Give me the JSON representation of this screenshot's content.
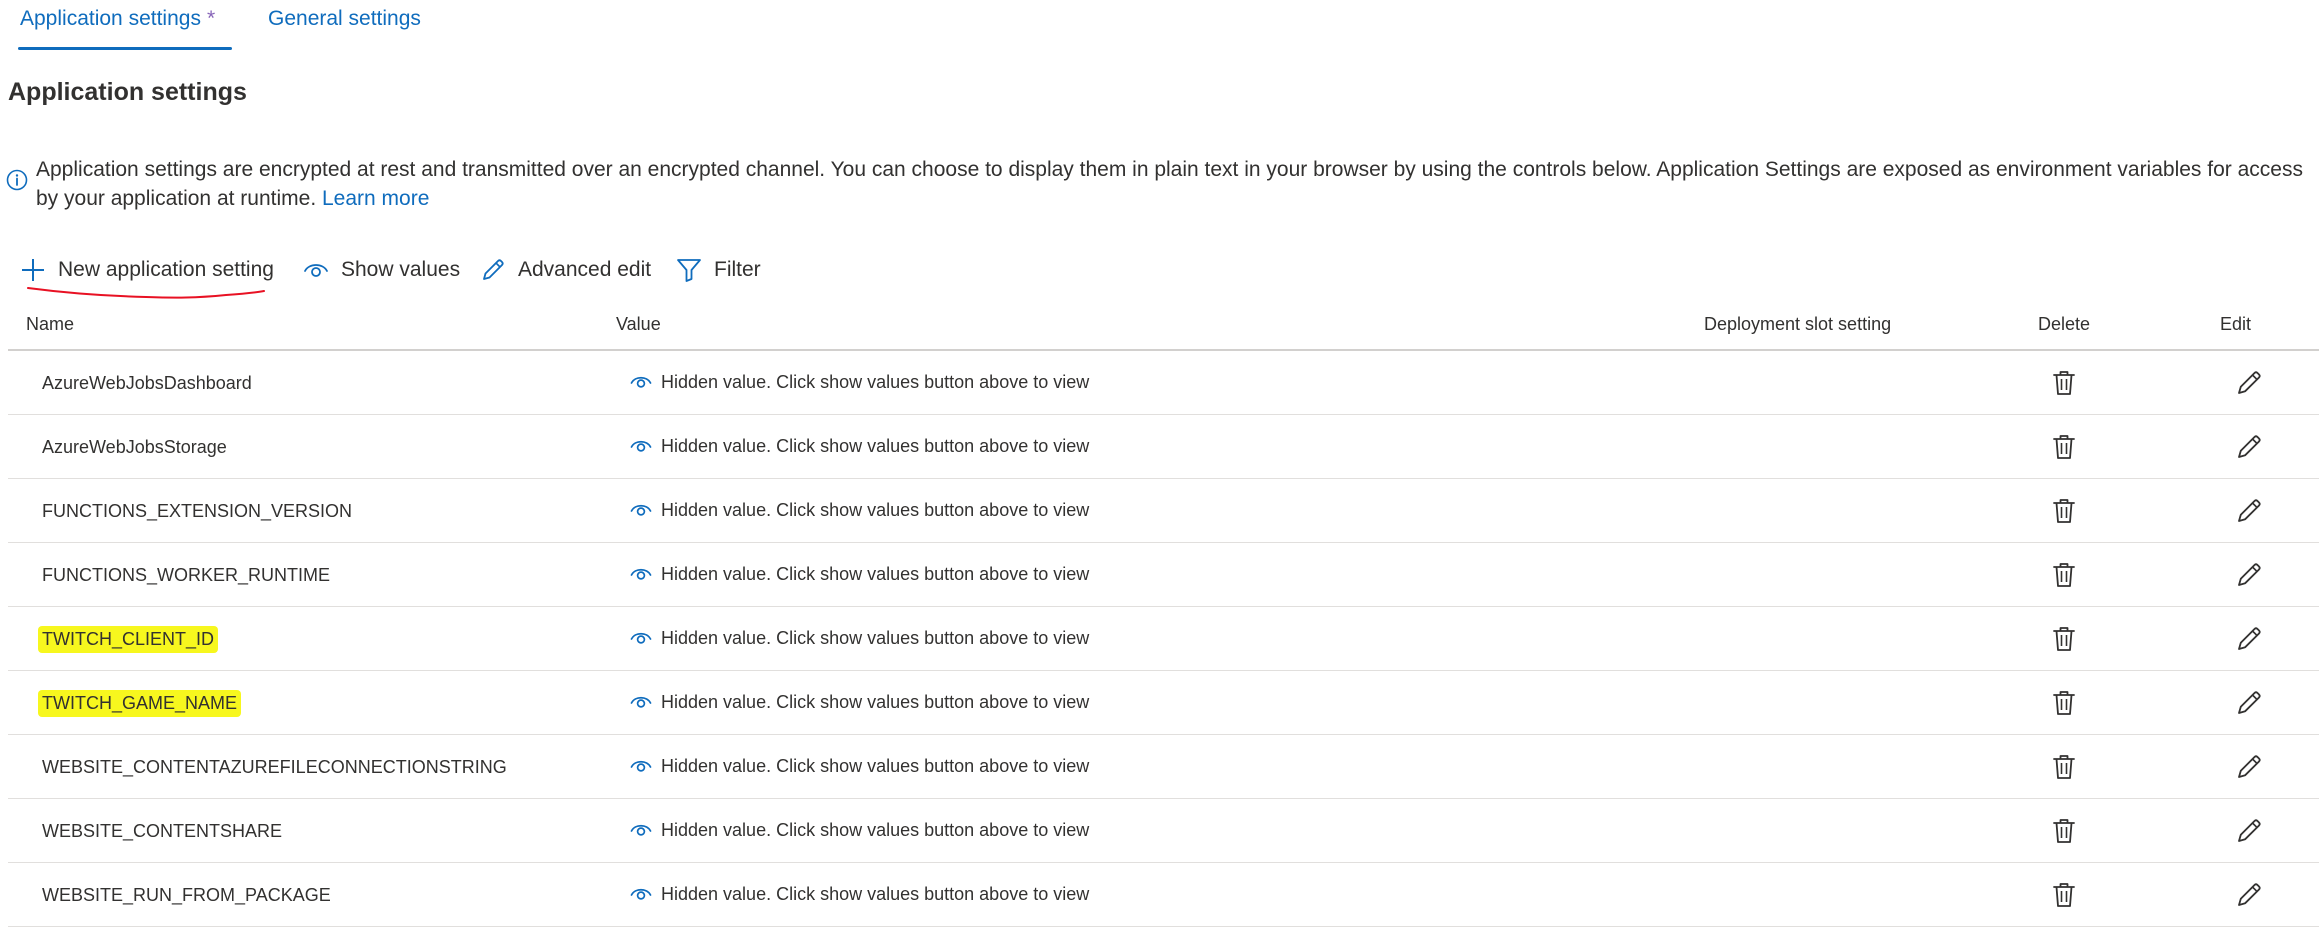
{
  "tabs": {
    "active_label": "Application settings",
    "active_modified_marker": "*",
    "general_label": "General settings"
  },
  "section": {
    "title": "Application settings"
  },
  "info": {
    "text": "Application settings are encrypted at rest and transmitted over an encrypted channel. You can choose to display them in plain text in your browser by using the controls below. Application Settings are exposed as environment variables for access by your application at runtime.",
    "learn_more": "Learn more"
  },
  "toolbar": {
    "new_label": "New application setting",
    "show_label": "Show values",
    "advanced_label": "Advanced edit",
    "filter_label": "Filter"
  },
  "table": {
    "columns": {
      "name": "Name",
      "value": "Value",
      "slot": "Deployment slot setting",
      "delete": "Delete",
      "edit": "Edit"
    },
    "rows": [
      {
        "name": "AzureWebJobsDashboard",
        "value": "Hidden value. Click show values button above to view",
        "highlighted": false
      },
      {
        "name": "AzureWebJobsStorage",
        "value": "Hidden value. Click show values button above to view",
        "highlighted": false
      },
      {
        "name": "FUNCTIONS_EXTENSION_VERSION",
        "value": "Hidden value. Click show values button above to view",
        "highlighted": false
      },
      {
        "name": "FUNCTIONS_WORKER_RUNTIME",
        "value": "Hidden value. Click show values button above to view",
        "highlighted": false
      },
      {
        "name": "TWITCH_CLIENT_ID",
        "value": "Hidden value. Click show values button above to view",
        "highlighted": true
      },
      {
        "name": "TWITCH_GAME_NAME",
        "value": "Hidden value. Click show values button above to view",
        "highlighted": true
      },
      {
        "name": "WEBSITE_CONTENTAZUREFILECONNECTIONSTRING",
        "value": "Hidden value. Click show values button above to view",
        "highlighted": false
      },
      {
        "name": "WEBSITE_CONTENTSHARE",
        "value": "Hidden value. Click show values button above to view",
        "highlighted": false
      },
      {
        "name": "WEBSITE_RUN_FROM_PACKAGE",
        "value": "Hidden value. Click show values button above to view",
        "highlighted": false
      }
    ]
  },
  "icons": {
    "info": "info-icon",
    "add": "plus-icon",
    "show": "eye-icon",
    "advanced": "pencil-icon",
    "filter": "filter-icon",
    "delete": "trash-icon",
    "edit": "pencil-icon"
  },
  "colors": {
    "accent": "#0f6cbd",
    "modified_marker": "#8764b8",
    "highlight": "#f7f71e",
    "annotation": "#e81123"
  }
}
